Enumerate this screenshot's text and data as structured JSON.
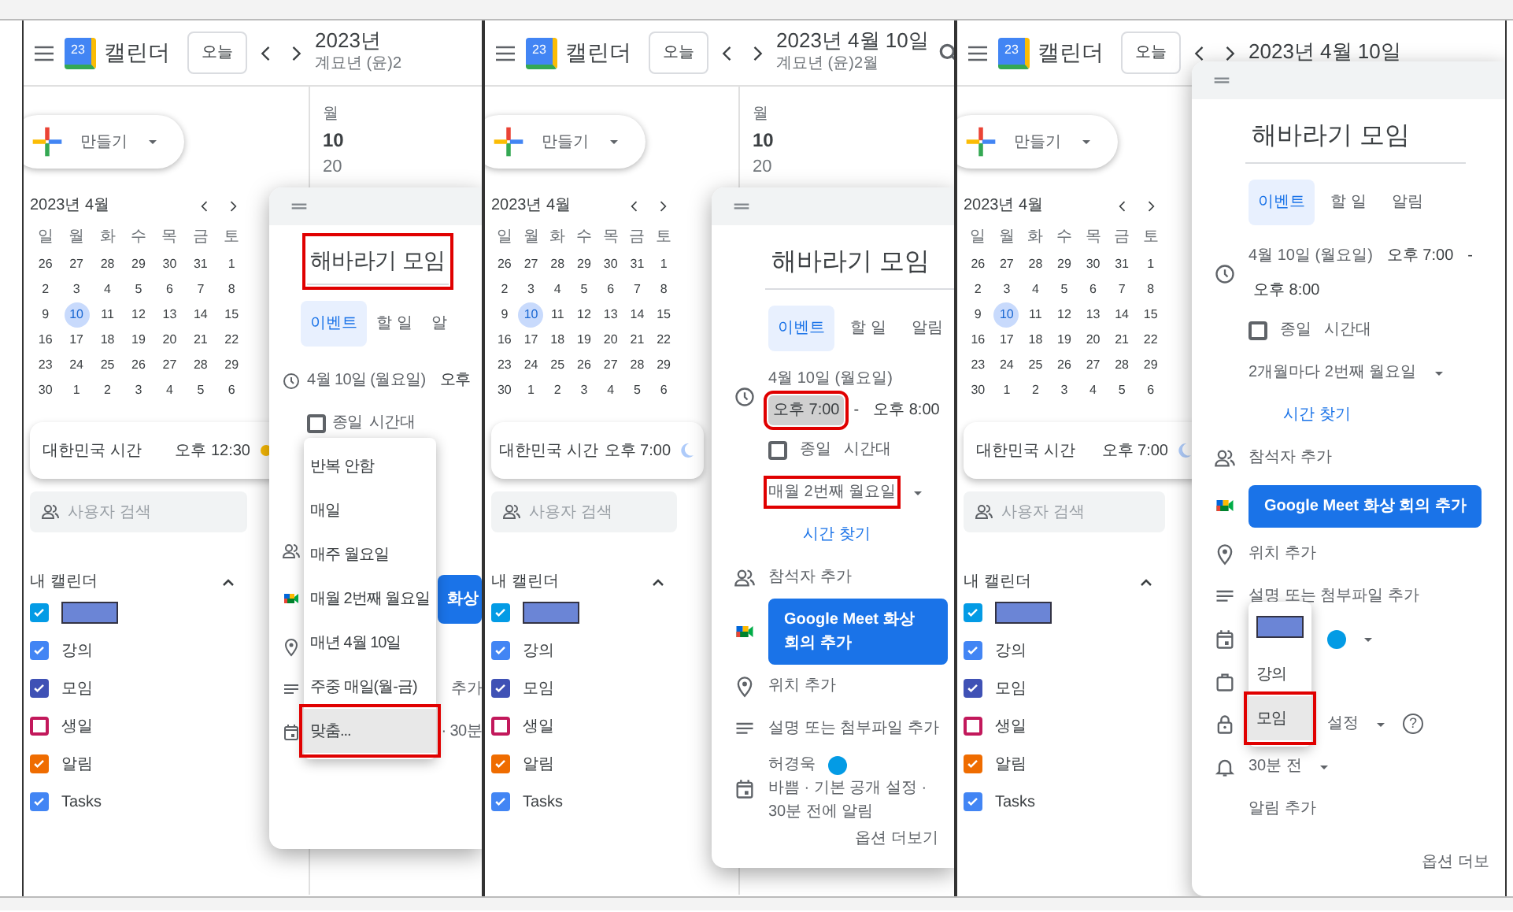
{
  "panels": [
    {
      "header": {
        "logo": "23",
        "app_name": "캘린더",
        "today": "오늘",
        "title": "2023년",
        "subtitle": "계묘년 (윤)2"
      },
      "day_header": {
        "weekday": "월",
        "day": "10",
        "number": "20"
      },
      "sidebar": {
        "create": "만들기",
        "month": "2023년 4월",
        "weekdays": [
          "일",
          "월",
          "화",
          "수",
          "목",
          "금",
          "토"
        ],
        "weeks": [
          [
            {
              "d": "26",
              "selected": false
            },
            {
              "d": "27",
              "selected": false
            },
            {
              "d": "28",
              "selected": false
            },
            {
              "d": "29",
              "selected": false
            },
            {
              "d": "30",
              "selected": false
            },
            {
              "d": "31",
              "selected": false
            },
            {
              "d": "1",
              "selected": false
            }
          ],
          [
            {
              "d": "2",
              "selected": false
            },
            {
              "d": "3",
              "selected": false
            },
            {
              "d": "4",
              "selected": false
            },
            {
              "d": "5",
              "selected": false
            },
            {
              "d": "6",
              "selected": false
            },
            {
              "d": "7",
              "selected": false
            },
            {
              "d": "8",
              "selected": false
            }
          ],
          [
            {
              "d": "9",
              "selected": false
            },
            {
              "d": "10",
              "selected": true
            },
            {
              "d": "11",
              "selected": false
            },
            {
              "d": "12",
              "selected": false
            },
            {
              "d": "13",
              "selected": false
            },
            {
              "d": "14",
              "selected": false
            },
            {
              "d": "15",
              "selected": false
            }
          ],
          [
            {
              "d": "16",
              "selected": false
            },
            {
              "d": "17",
              "selected": false
            },
            {
              "d": "18",
              "selected": false
            },
            {
              "d": "19",
              "selected": false
            },
            {
              "d": "20",
              "selected": false
            },
            {
              "d": "21",
              "selected": false
            },
            {
              "d": "22",
              "selected": false
            }
          ],
          [
            {
              "d": "23",
              "selected": false
            },
            {
              "d": "24",
              "selected": false
            },
            {
              "d": "25",
              "selected": false
            },
            {
              "d": "26",
              "selected": false
            },
            {
              "d": "27",
              "selected": false
            },
            {
              "d": "28",
              "selected": false
            },
            {
              "d": "29",
              "selected": false
            }
          ],
          [
            {
              "d": "30",
              "selected": false
            },
            {
              "d": "1",
              "selected": false
            },
            {
              "d": "2",
              "selected": false
            },
            {
              "d": "3",
              "selected": false
            },
            {
              "d": "4",
              "selected": false
            },
            {
              "d": "5",
              "selected": false
            },
            {
              "d": "6",
              "selected": false
            }
          ]
        ],
        "clock": {
          "label": "대한민국 시간",
          "time": "오후 12:30",
          "kind": "day"
        },
        "search": {
          "placeholder": "사용자 검색"
        },
        "my_calendars": {
          "title": "내 캘린더",
          "expanded": true,
          "items": [
            {
              "redacted": true,
              "checked": true,
              "color": "#039be5"
            },
            {
              "label": "강의",
              "checked": true,
              "color": "#4285f4"
            },
            {
              "label": "모임",
              "checked": true,
              "color": "#3f51b5"
            },
            {
              "label": "생일",
              "checked": false,
              "color": "#c2185b"
            },
            {
              "label": "알림",
              "checked": true,
              "color": "#ef6c00"
            },
            {
              "label": "Tasks",
              "checked": true,
              "color": "#4285f4"
            }
          ]
        }
      },
      "dialog": {
        "title": "해바라기 모임",
        "title_highlighted": true,
        "tabs": [
          {
            "label": "이벤트",
            "selected": true
          },
          {
            "label": "할 일",
            "selected": false
          },
          {
            "label": "알",
            "selected": false
          }
        ],
        "rows": [
          {
            "kind": "datetime",
            "date": "4월 10일 (월요일)",
            "start": "오후",
            "start_highlighted": false
          },
          {
            "kind": "allday",
            "checked": false,
            "label": "종일",
            "extra": "시간대"
          },
          {
            "kind": "recurrence",
            "menu": {
              "items": [
                {
                  "label": "반복 안함",
                  "selected": false,
                  "highlighted": false
                },
                {
                  "label": "매일",
                  "selected": false,
                  "highlighted": false
                },
                {
                  "label": "매주 월요일",
                  "selected": false,
                  "highlighted": false
                },
                {
                  "label": "매월 2번째 월요일",
                  "selected": false,
                  "highlighted": false
                },
                {
                  "label": "매년 4월 10일",
                  "selected": false,
                  "highlighted": false
                },
                {
                  "label": "주중 매일(월-금)",
                  "selected": false,
                  "highlighted": false
                },
                {
                  "label": "맞춤...",
                  "selected": true,
                  "highlighted": true
                }
              ]
            }
          },
          {
            "kind": "link"
          },
          {
            "kind": "attendees"
          },
          {
            "kind": "meet",
            "text": "화상",
            "partly_hidden": true
          },
          {
            "kind": "location"
          },
          {
            "kind": "description",
            "text": "추가",
            "partly_hidden": true
          },
          {
            "kind": "calendar",
            "sub": "· 30분",
            "partly_hidden": true
          }
        ]
      }
    },
    {
      "header": {
        "logo": "23",
        "app_name": "캘린더",
        "today": "오늘",
        "title": "2023년 4월 10일",
        "subtitle": "계묘년 (윤)2월",
        "search_icon": true
      },
      "day_header": {
        "weekday": "월",
        "day": "10",
        "number": "20"
      },
      "sidebar": {
        "create": "만들기",
        "month": "2023년 4월",
        "weekdays": [
          "일",
          "월",
          "화",
          "수",
          "목",
          "금",
          "토"
        ],
        "weeks": [
          [
            {
              "d": "26",
              "selected": false
            },
            {
              "d": "27",
              "selected": false
            },
            {
              "d": "28",
              "selected": false
            },
            {
              "d": "29",
              "selected": false
            },
            {
              "d": "30",
              "selected": false
            },
            {
              "d": "31",
              "selected": false
            },
            {
              "d": "1",
              "selected": false
            }
          ],
          [
            {
              "d": "2",
              "selected": false
            },
            {
              "d": "3",
              "selected": false
            },
            {
              "d": "4",
              "selected": false
            },
            {
              "d": "5",
              "selected": false
            },
            {
              "d": "6",
              "selected": false
            },
            {
              "d": "7",
              "selected": false
            },
            {
              "d": "8",
              "selected": false
            }
          ],
          [
            {
              "d": "9",
              "selected": false
            },
            {
              "d": "10",
              "selected": true
            },
            {
              "d": "11",
              "selected": false
            },
            {
              "d": "12",
              "selected": false
            },
            {
              "d": "13",
              "selected": false
            },
            {
              "d": "14",
              "selected": false
            },
            {
              "d": "15",
              "selected": false
            }
          ],
          [
            {
              "d": "16",
              "selected": false
            },
            {
              "d": "17",
              "selected": false
            },
            {
              "d": "18",
              "selected": false
            },
            {
              "d": "19",
              "selected": false
            },
            {
              "d": "20",
              "selected": false
            },
            {
              "d": "21",
              "selected": false
            },
            {
              "d": "22",
              "selected": false
            }
          ],
          [
            {
              "d": "23",
              "selected": false
            },
            {
              "d": "24",
              "selected": false
            },
            {
              "d": "25",
              "selected": false
            },
            {
              "d": "26",
              "selected": false
            },
            {
              "d": "27",
              "selected": false
            },
            {
              "d": "28",
              "selected": false
            },
            {
              "d": "29",
              "selected": false
            }
          ],
          [
            {
              "d": "30",
              "selected": false
            },
            {
              "d": "1",
              "selected": false
            },
            {
              "d": "2",
              "selected": false
            },
            {
              "d": "3",
              "selected": false
            },
            {
              "d": "4",
              "selected": false
            },
            {
              "d": "5",
              "selected": false
            },
            {
              "d": "6",
              "selected": false
            }
          ]
        ],
        "clock": {
          "label": "대한민국 시간",
          "time": "오후 7:00",
          "kind": "night"
        },
        "search": {
          "placeholder": "사용자 검색"
        },
        "my_calendars": {
          "title": "내 캘린더",
          "expanded": true,
          "items": [
            {
              "redacted": true,
              "checked": true,
              "color": "#039be5"
            },
            {
              "label": "강의",
              "checked": true,
              "color": "#4285f4"
            },
            {
              "label": "모임",
              "checked": true,
              "color": "#3f51b5"
            },
            {
              "label": "생일",
              "checked": false,
              "color": "#c2185b"
            },
            {
              "label": "알림",
              "checked": true,
              "color": "#ef6c00"
            },
            {
              "label": "Tasks",
              "checked": true,
              "color": "#4285f4"
            }
          ]
        }
      },
      "dialog": {
        "title": "해바라기 모임",
        "title_highlighted": false,
        "tabs": [
          {
            "label": "이벤트",
            "selected": true
          },
          {
            "label": "할 일",
            "selected": false
          },
          {
            "label": "알림",
            "selected": false
          }
        ],
        "rows": [
          {
            "kind": "datetime",
            "date": "4월 10일 (월요일)",
            "start": "오후 7:00",
            "start_highlighted": true,
            "separator": "-",
            "end": "오후 8:00"
          },
          {
            "kind": "allday",
            "checked": false,
            "label": "종일",
            "extra": "시간대"
          },
          {
            "kind": "recurrence",
            "text": "매월 2번째 월요일",
            "highlighted": true
          },
          {
            "kind": "link",
            "text": "시간 찾기"
          },
          {
            "kind": "attendees",
            "text": "참석자 추가"
          },
          {
            "kind": "meet",
            "text": "Google Meet 화상 회의 추가"
          },
          {
            "kind": "location",
            "text": "위치 추가"
          },
          {
            "kind": "description",
            "text": "설명 또는 첨부파일 추가"
          },
          {
            "kind": "calendar",
            "text": "허경욱",
            "color": "#039be5",
            "sub": "바쁨 · 기본 공개 설정 · 30분 전에 알림"
          }
        ],
        "footer": "옵션 더보기"
      }
    },
    {
      "header": {
        "logo": "23",
        "app_name": "캘린더",
        "today": "오늘",
        "title": "2023년 4월 10일"
      },
      "sidebar": {
        "create": "만들기",
        "month": "2023년 4월",
        "weekdays": [
          "일",
          "월",
          "화",
          "수",
          "목",
          "금",
          "토"
        ],
        "weeks": [
          [
            {
              "d": "26",
              "selected": false
            },
            {
              "d": "27",
              "selected": false
            },
            {
              "d": "28",
              "selected": false
            },
            {
              "d": "29",
              "selected": false
            },
            {
              "d": "30",
              "selected": false
            },
            {
              "d": "31",
              "selected": false
            },
            {
              "d": "1",
              "selected": false
            }
          ],
          [
            {
              "d": "2",
              "selected": false
            },
            {
              "d": "3",
              "selected": false
            },
            {
              "d": "4",
              "selected": false
            },
            {
              "d": "5",
              "selected": false
            },
            {
              "d": "6",
              "selected": false
            },
            {
              "d": "7",
              "selected": false
            },
            {
              "d": "8",
              "selected": false
            }
          ],
          [
            {
              "d": "9",
              "selected": false
            },
            {
              "d": "10",
              "selected": true
            },
            {
              "d": "11",
              "selected": false
            },
            {
              "d": "12",
              "selected": false
            },
            {
              "d": "13",
              "selected": false
            },
            {
              "d": "14",
              "selected": false
            },
            {
              "d": "15",
              "selected": false
            }
          ],
          [
            {
              "d": "16",
              "selected": false
            },
            {
              "d": "17",
              "selected": false
            },
            {
              "d": "18",
              "selected": false
            },
            {
              "d": "19",
              "selected": false
            },
            {
              "d": "20",
              "selected": false
            },
            {
              "d": "21",
              "selected": false
            },
            {
              "d": "22",
              "selected": false
            }
          ],
          [
            {
              "d": "23",
              "selected": false
            },
            {
              "d": "24",
              "selected": false
            },
            {
              "d": "25",
              "selected": false
            },
            {
              "d": "26",
              "selected": false
            },
            {
              "d": "27",
              "selected": false
            },
            {
              "d": "28",
              "selected": false
            },
            {
              "d": "29",
              "selected": false
            }
          ],
          [
            {
              "d": "30",
              "selected": false
            },
            {
              "d": "1",
              "selected": false
            },
            {
              "d": "2",
              "selected": false
            },
            {
              "d": "3",
              "selected": false
            },
            {
              "d": "4",
              "selected": false
            },
            {
              "d": "5",
              "selected": false
            },
            {
              "d": "6",
              "selected": false
            }
          ]
        ],
        "clock": {
          "label": "대한민국 시간",
          "time": "오후 7:00",
          "kind": "night"
        },
        "search": {
          "placeholder": "사용자 검색"
        },
        "my_calendars": {
          "title": "내 캘린더",
          "expanded": true,
          "items": [
            {
              "redacted": true,
              "checked": true,
              "color": "#039be5"
            },
            {
              "label": "강의",
              "checked": true,
              "color": "#4285f4"
            },
            {
              "label": "모임",
              "checked": true,
              "color": "#3f51b5"
            },
            {
              "label": "생일",
              "checked": false,
              "color": "#c2185b"
            },
            {
              "label": "알림",
              "checked": true,
              "color": "#ef6c00"
            },
            {
              "label": "Tasks",
              "checked": true,
              "color": "#4285f4"
            }
          ]
        }
      },
      "dialog": {
        "title": "해바라기 모임",
        "title_highlighted": false,
        "tabs": [
          {
            "label": "이벤트",
            "selected": true
          },
          {
            "label": "할 일",
            "selected": false
          },
          {
            "label": "알림",
            "selected": false
          }
        ],
        "rows": [
          {
            "kind": "datetime",
            "date": "4월 10일 (월요일)",
            "start": "오후 7:00",
            "start_highlighted": false,
            "separator": "-",
            "end": "오후 8:00"
          },
          {
            "kind": "allday",
            "checked": false,
            "label": "종일",
            "extra": "시간대"
          },
          {
            "kind": "recurrence",
            "text": "2개월마다 2번째 월요일"
          },
          {
            "kind": "link",
            "text": "시간 찾기"
          },
          {
            "kind": "attendees",
            "text": "참석자 추가"
          },
          {
            "kind": "meet",
            "text": "Google Meet 화상 회의 추가"
          },
          {
            "kind": "location",
            "text": "위치 추가"
          },
          {
            "kind": "description",
            "text": "설명 또는 첨부파일 추가"
          },
          {
            "kind": "calendar",
            "color": "#039be5",
            "partly_hidden": true,
            "menu": {
              "items": [
                {
                  "redacted": true,
                  "selected": false,
                  "highlighted": false
                },
                {
                  "label": "강의",
                  "selected": false,
                  "highlighted": false
                },
                {
                  "label": "모임",
                  "selected": true,
                  "highlighted": true
                }
              ]
            }
          },
          {
            "kind": "busy"
          },
          {
            "kind": "visibility",
            "text": "설정",
            "help": "?",
            "partly_hidden": true
          },
          {
            "kind": "notification",
            "text": "30분 전"
          },
          {
            "kind": "add_notification",
            "text": "알림 추가"
          }
        ],
        "footer": "옵션 더보"
      }
    }
  ]
}
